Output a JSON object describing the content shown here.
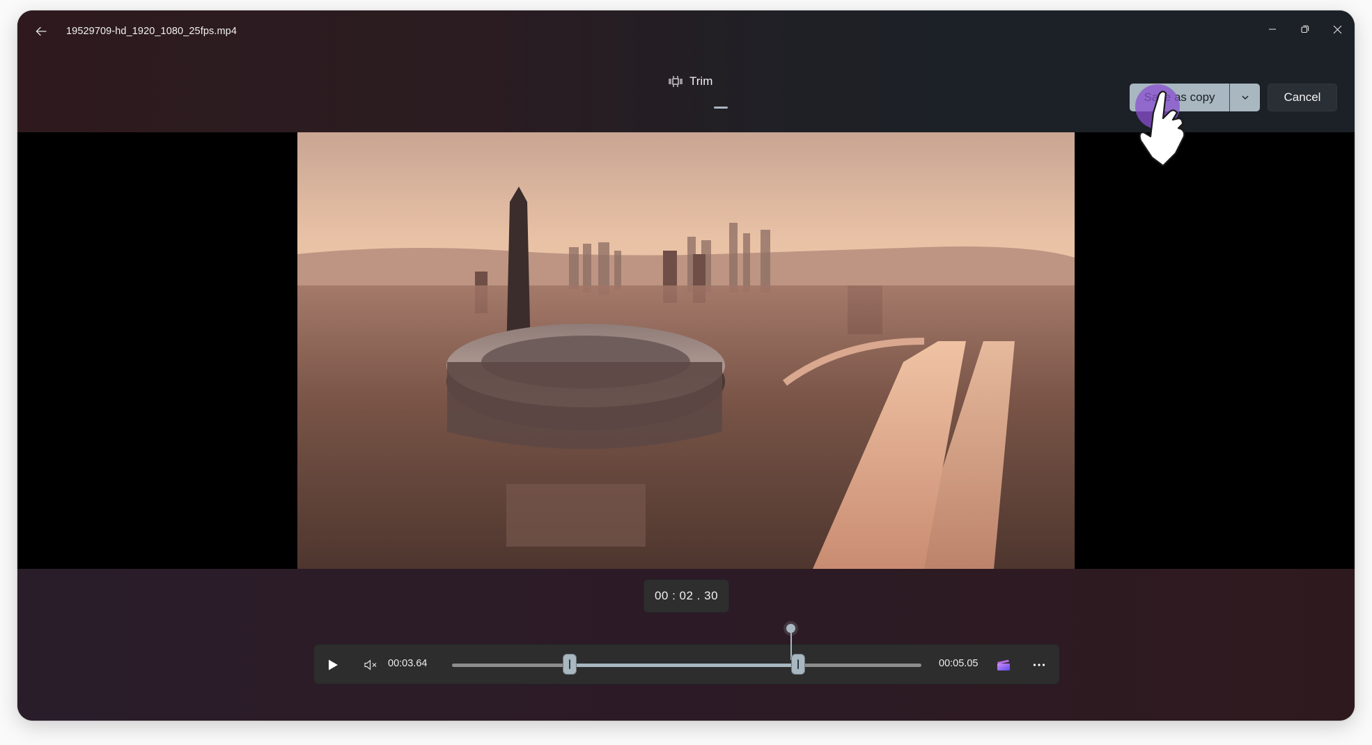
{
  "window": {
    "title": "19529709-hd_1920_1080_25fps.mp4",
    "controls": [
      "minimize",
      "restore",
      "close"
    ]
  },
  "icons": {
    "back": "arrow-left-icon",
    "trim": "trim-icon",
    "dropdown": "chevron-down-icon",
    "play": "play-icon",
    "mute": "volume-mute-icon",
    "clipchamp": "clapperboard-icon",
    "more": "more-horizontal-icon"
  },
  "toolbar": {
    "tab_label": "Trim",
    "save_label": "Save as copy",
    "cancel_label": "Cancel"
  },
  "video": {
    "description": "Aerial sunset view of a stadium beside a multi-lane highway with city skyline"
  },
  "player": {
    "current_time": "00 : 02 . 30",
    "trim_start": "00:03.64",
    "trim_end": "00:05.05",
    "trim_start_fraction": 0.25,
    "trim_end_fraction": 0.737,
    "playhead_fraction": 0.722
  },
  "colors": {
    "accent": "#a8b7c0",
    "header_left": "#2e1a1e",
    "header_right": "#1c2127",
    "controls_bg": "#2d2d2d",
    "cursor_highlight": "#8a4fd0"
  }
}
